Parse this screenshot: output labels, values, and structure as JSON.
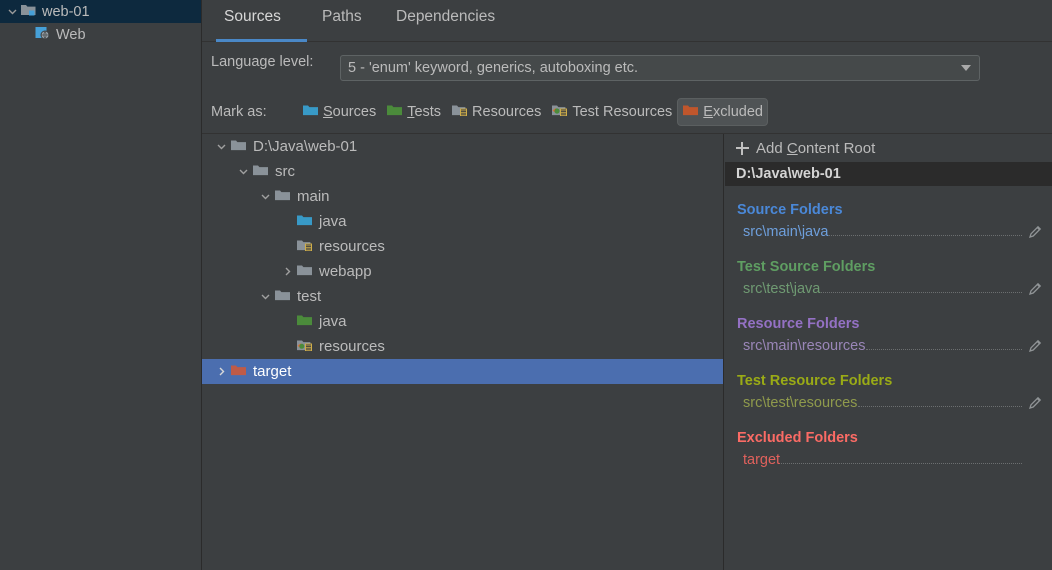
{
  "module_panel": {
    "rows": [
      {
        "label": "web-01",
        "icon": "module-folder-icon",
        "selected": true,
        "indent": 0,
        "expanded": true
      },
      {
        "label": "Web",
        "icon": "web-facet-icon",
        "selected": false,
        "indent": 1,
        "expanded": null
      }
    ]
  },
  "tabs": [
    {
      "label": "Sources",
      "active": true
    },
    {
      "label": "Paths",
      "active": false
    },
    {
      "label": "Dependencies",
      "active": false
    }
  ],
  "language_level": {
    "label": "Language level:",
    "value": "5 - 'enum' keyword, generics, autoboxing etc.",
    "arrow_icon": "chevron-down-icon"
  },
  "mark_as": {
    "label": "Mark as:",
    "buttons": [
      {
        "label": "Sources",
        "mnemonic": "S",
        "icon": "sources-folder-icon",
        "pressed": false
      },
      {
        "label": "Tests",
        "mnemonic": "T",
        "icon": "tests-folder-icon",
        "pressed": false
      },
      {
        "label": "Resources",
        "mnemonic": "",
        "icon": "resources-folder-icon",
        "pressed": false
      },
      {
        "label": "Test Resources",
        "mnemonic": "",
        "icon": "test-resources-folder-icon",
        "pressed": false
      },
      {
        "label": "Excluded",
        "mnemonic": "E",
        "icon": "excluded-folder-icon",
        "pressed": true
      }
    ]
  },
  "tree": {
    "rows": [
      {
        "label": "D:\\Java\\web-01",
        "indent": 0,
        "toggle": "expanded",
        "icon": "folder-plain-icon",
        "selected": false
      },
      {
        "label": "src",
        "indent": 1,
        "toggle": "expanded",
        "icon": "folder-plain-icon",
        "selected": false
      },
      {
        "label": "main",
        "indent": 2,
        "toggle": "expanded",
        "icon": "folder-plain-icon",
        "selected": false
      },
      {
        "label": "java",
        "indent": 3,
        "toggle": "none",
        "icon": "sources-folder-icon",
        "selected": false
      },
      {
        "label": "resources",
        "indent": 3,
        "toggle": "none",
        "icon": "resources-folder-icon",
        "selected": false
      },
      {
        "label": "webapp",
        "indent": 2,
        "toggle": "collapsed",
        "icon": "folder-plain-icon",
        "selected": false
      },
      {
        "label": "test",
        "indent": 1,
        "toggle": "expanded",
        "icon": "folder-plain-icon",
        "selected": false
      },
      {
        "label": "java",
        "indent": 2,
        "toggle": "none",
        "icon": "tests-folder-icon",
        "selected": false
      },
      {
        "label": "resources",
        "indent": 2,
        "toggle": "none",
        "icon": "test-resources-folder-icon",
        "selected": false
      },
      {
        "label": "target",
        "indent": 0,
        "toggle": "collapsed",
        "icon": "excluded-folder-icon",
        "selected": true
      }
    ]
  },
  "detail_panel": {
    "add_content_root": {
      "label_pre": "Add ",
      "mnemonic": "C",
      "label_post": "ontent Root",
      "icon": "plus-icon"
    },
    "content_root": "D:\\Java\\web-01",
    "groups": [
      {
        "title": "Source Folders",
        "color": "#4a88d8",
        "items": [
          {
            "path": "src\\main\\java",
            "has_edit": true,
            "edit_icon": "pencil-icon"
          }
        ]
      },
      {
        "title": "Test Source Folders",
        "color": "#5f9e62",
        "items": [
          {
            "path": "src\\test\\java",
            "has_edit": true,
            "edit_icon": "pencil-icon"
          }
        ]
      },
      {
        "title": "Resource Folders",
        "color": "#9471c4",
        "items": [
          {
            "path": "src\\main\\resources",
            "has_edit": true,
            "edit_icon": "pencil-icon"
          }
        ]
      },
      {
        "title": "Test Resource Folders",
        "color": "#9aab16",
        "items": [
          {
            "path": "src\\test\\resources",
            "has_edit": true,
            "edit_icon": "pencil-icon"
          }
        ]
      },
      {
        "title": "Excluded Folders",
        "color": "#fb6b65",
        "items": [
          {
            "path": "target",
            "has_edit": false,
            "edit_icon": ""
          }
        ]
      }
    ]
  },
  "theme": {
    "background": "#3c3f41",
    "selection_blue": "#4b6eaf",
    "selection_navy": "#0d293e",
    "tab_accent": "#4a88c7",
    "text": "#bbbbbb",
    "header_dark": "#2b2b2b"
  }
}
